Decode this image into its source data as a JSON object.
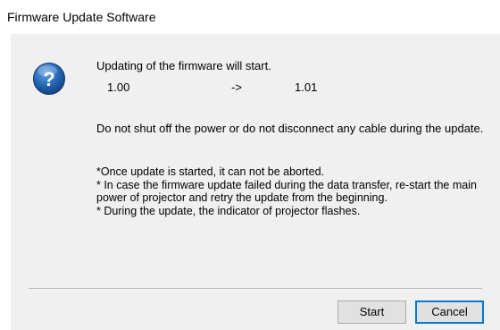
{
  "window": {
    "title": "Firmware Update Software"
  },
  "dialog": {
    "icon": "question-icon",
    "heading": "Updating of the firmware will start.",
    "current_version": "1.00",
    "arrow": "->",
    "new_version": "1.01",
    "warning": "Do not shut off the power or do not disconnect any cable during the update.",
    "notes": [
      "*Once update is started, it can not be aborted.",
      "* In case the firmware update failed during the data transfer, re-start the main",
      "power of projector and retry the update from the beginning.",
      "* During the update, the indicator of projector flashes."
    ]
  },
  "buttons": {
    "start_label": "Start",
    "cancel_label": "Cancel"
  },
  "colors": {
    "client_background": "#f0f0f0",
    "icon_blue": "#1d5fa8",
    "focus_border": "#0078d7"
  }
}
